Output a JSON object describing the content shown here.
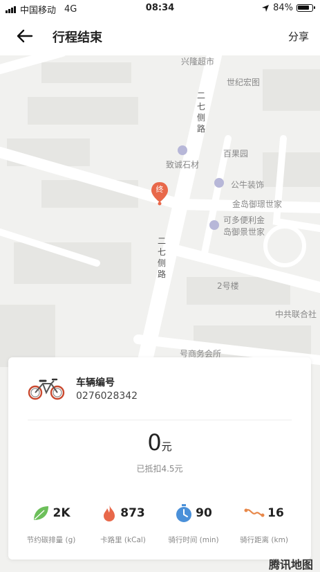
{
  "status_bar": {
    "carrier": "中国移动",
    "network": "4G",
    "time": "08:34",
    "battery": "84%"
  },
  "nav": {
    "title": "行程结束",
    "share_label": "分享"
  },
  "map": {
    "labels": {
      "xinglong": "兴隆超市",
      "shiji": "世纪宏图",
      "zhicheng": "致诚石材",
      "baiguo": "百果园",
      "gongniu": "公牛装饰",
      "jindao": "金岛御璟世家",
      "kedu1": "可多便利金",
      "kedu2": "岛御景世家",
      "erhao": "2号楼",
      "zhonggong": "中共联合社",
      "bottom": "号商务会所",
      "road1": "二七侧路",
      "road2": "二七侧路"
    },
    "end_marker": "终",
    "watermark": "腾讯地图"
  },
  "trip": {
    "vehicle_label": "车辆编号",
    "vehicle_number": "0276028342",
    "fare_amount": "0",
    "fare_unit": "元",
    "deduction": "已抵扣4.5元"
  },
  "stats": [
    {
      "value": "2K",
      "label": "节约碳排量 (g)",
      "icon": "leaf-icon",
      "color": "#6cbf5a"
    },
    {
      "value": "873",
      "label": "卡路里 (kCal)",
      "icon": "flame-icon",
      "color": "#e8684a"
    },
    {
      "value": "90",
      "label": "骑行时间 (min)",
      "icon": "stopwatch-icon",
      "color": "#4a90d9"
    },
    {
      "value": "16",
      "label": "骑行距离 (km)",
      "icon": "route-icon",
      "color": "#e8884a"
    }
  ]
}
